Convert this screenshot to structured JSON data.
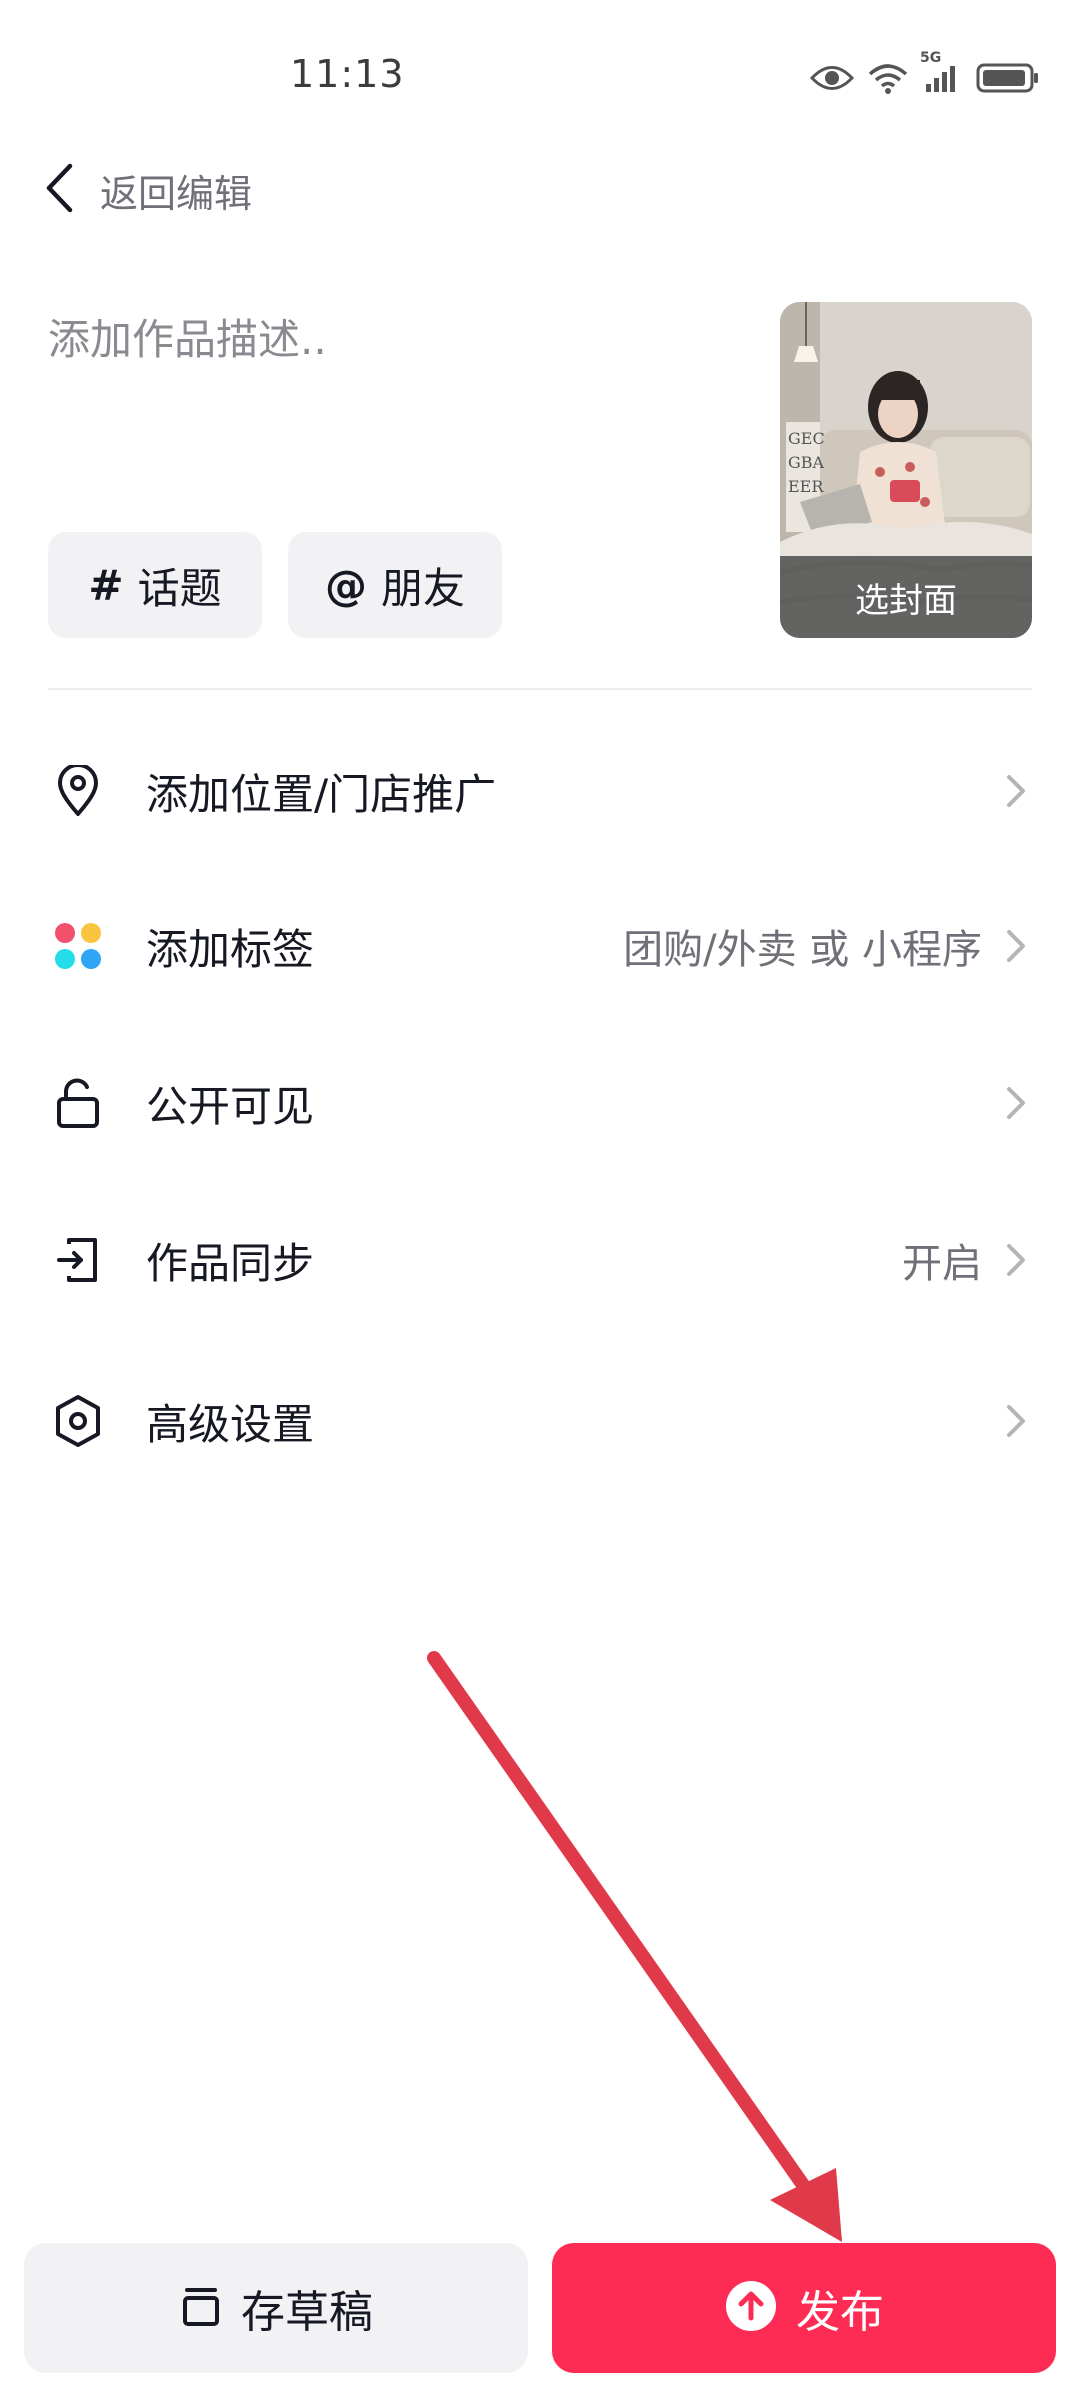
{
  "status_bar": {
    "time": "11:13",
    "network": "5G",
    "icons": [
      "eye-icon",
      "wifi-icon",
      "cellular-signal-icon",
      "battery-icon"
    ]
  },
  "header": {
    "back_label": "返回编辑"
  },
  "description": {
    "placeholder": "添加作品描述.."
  },
  "chips": {
    "topic": {
      "symbol": "#",
      "label": "话题"
    },
    "friend": {
      "symbol": "@",
      "label": "朋友"
    }
  },
  "cover": {
    "label": "选封面"
  },
  "menu": {
    "items": [
      {
        "label": "添加位置/门店推广",
        "value": "",
        "icon": "location-pin-icon"
      },
      {
        "label": "添加标签",
        "value": "团购/外卖 或 小程序",
        "icon": "colored-dots-icon"
      },
      {
        "label": "公开可见",
        "value": "",
        "icon": "unlock-icon"
      },
      {
        "label": "作品同步",
        "value": "开启",
        "icon": "sync-export-icon"
      },
      {
        "label": "高级设置",
        "value": "",
        "icon": "hexagon-settings-icon"
      }
    ]
  },
  "actions": {
    "draft_label": "存草稿",
    "publish_label": "发布"
  },
  "colors": {
    "accent": "#fe2c55",
    "annotation_arrow": "#e03a4a",
    "text_primary": "#161823",
    "text_secondary": "#6f7078"
  }
}
